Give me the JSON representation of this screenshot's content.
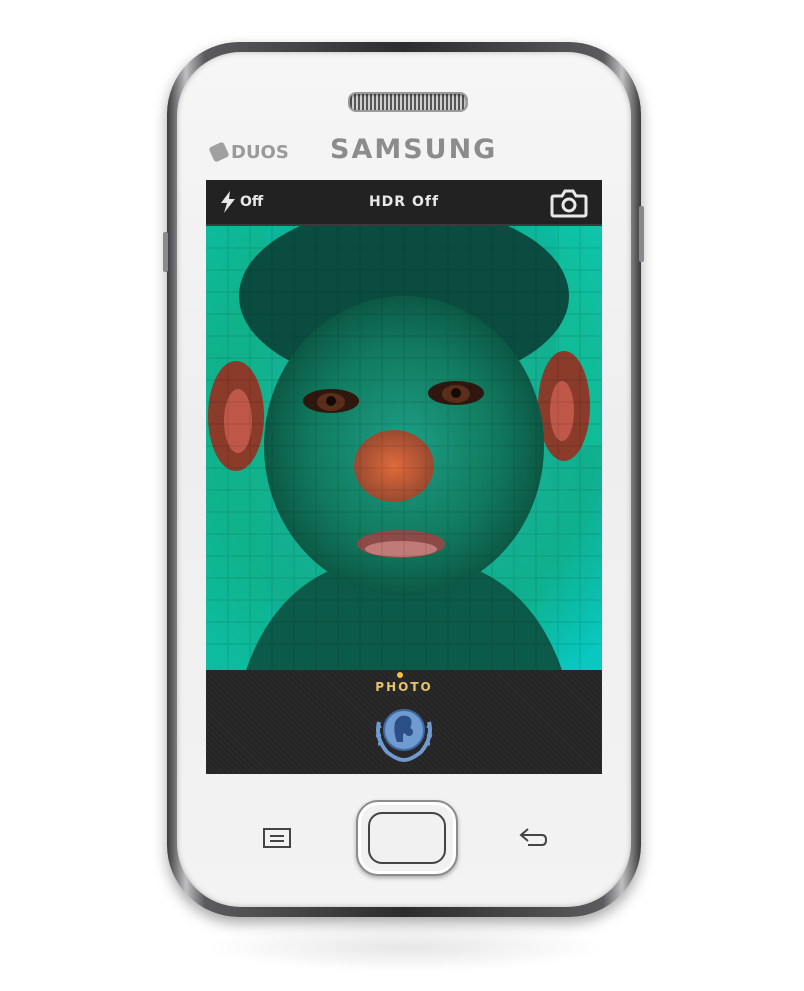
{
  "phone": {
    "brand": "SAMSUNG",
    "model_badge": "DUOS",
    "body_color": "#f2f2f2",
    "frame_color": "#2c2c2e"
  },
  "camera_app": {
    "flash": {
      "icon": "lightning-bolt-icon",
      "label": "Off"
    },
    "hdr_label": "HDR Off",
    "switch_camera_icon": "camera-icon",
    "mode_label": "PHOTO",
    "shutter_icon": "un-emblem-icon",
    "accent_color": "#e6c36a"
  },
  "keys": {
    "menu_icon": "menu-icon",
    "home_icon": "home-key",
    "back_icon": "back-arrow-icon"
  }
}
